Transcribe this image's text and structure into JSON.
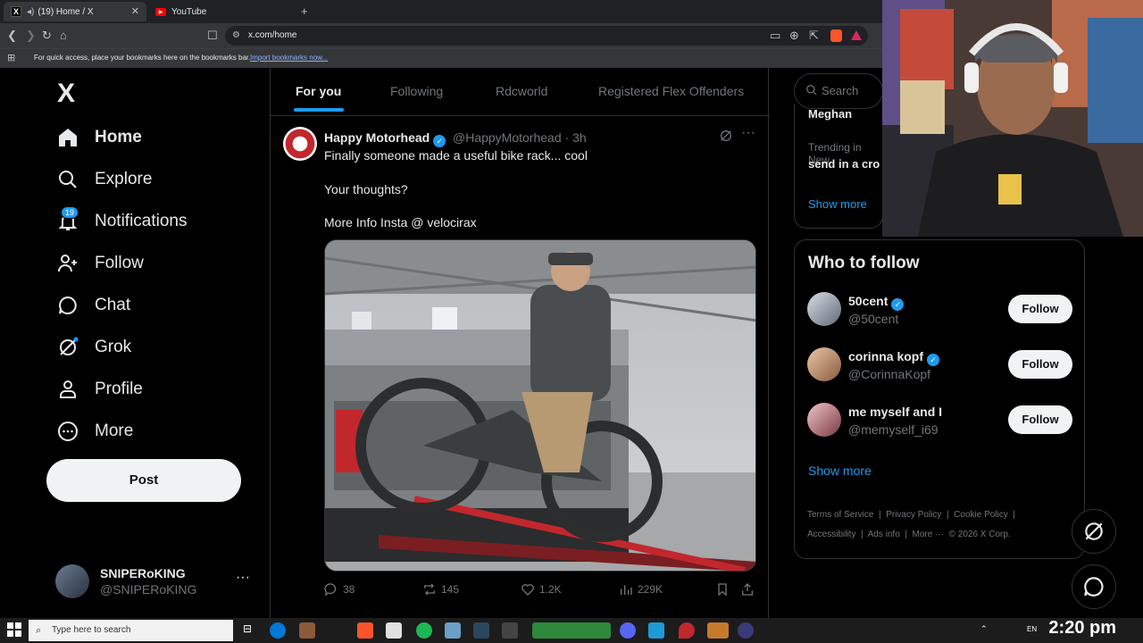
{
  "browser": {
    "tabs": [
      {
        "label": "(19) Home / X",
        "active": true
      },
      {
        "label": "YouTube",
        "active": false
      }
    ],
    "new_tab": "+",
    "url": "x.com/home",
    "bookmarks_hint": "For quick access, place your bookmarks here on the bookmarks bar.",
    "bookmarks_link": "Import bookmarks now..."
  },
  "nav": {
    "logo": "X",
    "items": [
      {
        "label": "Home",
        "icon": "home-icon"
      },
      {
        "label": "Explore",
        "icon": "search-icon"
      },
      {
        "label": "Notifications",
        "icon": "bell-icon"
      },
      {
        "label": "Follow",
        "icon": "follow-icon"
      },
      {
        "label": "Chat",
        "icon": "chat-icon"
      },
      {
        "label": "Grok",
        "icon": "grok-icon"
      },
      {
        "label": "Profile",
        "icon": "profile-icon"
      },
      {
        "label": "More",
        "icon": "more-icon"
      }
    ],
    "notification_count": "19",
    "post_label": "Post",
    "account": {
      "name": "SNIPERoKING",
      "handle": "@SNIPERoKING",
      "more": "···"
    }
  },
  "feed": {
    "tabs": [
      "For you",
      "Following",
      "Rdcworld",
      "Registered Flex Offenders"
    ],
    "tweet": {
      "author": "Happy Motorhead",
      "handle": "@HappyMotorhead",
      "time": "· 3h",
      "lines": [
        "Finally someone made a useful bike rack... cool",
        "Your thoughts?",
        "More Info Insta @ velocirax"
      ],
      "stats": {
        "replies": "38",
        "reposts": "145",
        "likes": "1.2K",
        "views": "229K"
      }
    }
  },
  "right": {
    "search_placeholder": "Search",
    "trend_top": "Meghan",
    "trend_label": "Trending in New",
    "trend_title": "send in a cro",
    "show_more_trends": "Show more",
    "who_to_follow": "Who to follow",
    "suggestions": [
      {
        "name": "50cent",
        "handle": "@50cent",
        "verified": true
      },
      {
        "name": "corinna kopf",
        "handle": "@CorinnaKopf",
        "verified": true
      },
      {
        "name": "me myself and I",
        "handle": "@memyself_i69",
        "verified": false
      }
    ],
    "follow_label": "Follow",
    "show_more_follow": "Show more",
    "footer": {
      "terms": "Terms of Service",
      "privacy": "Privacy Policy",
      "cookie": "Cookie Policy",
      "accessibility": "Accessibility",
      "ads": "Ads info",
      "more": "More ···",
      "copyright": "© 2026 X Corp."
    }
  },
  "taskbar": {
    "search_placeholder": "Type here to search",
    "clock": "2:20 pm",
    "tray_lang": "EN"
  },
  "colors": {
    "accent": "#1d9bf0",
    "background": "#000000",
    "border": "#2f3336"
  }
}
